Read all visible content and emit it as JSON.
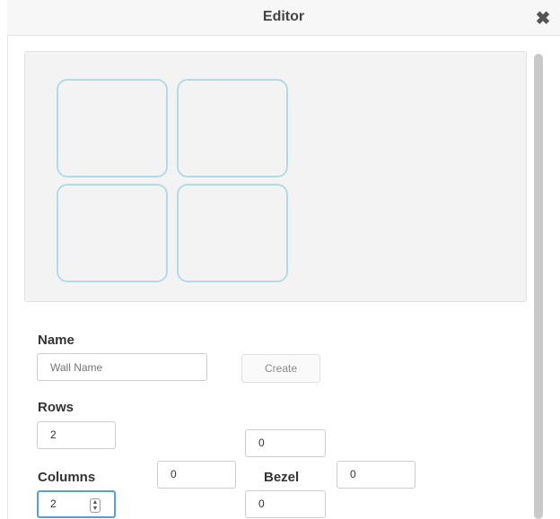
{
  "dialog": {
    "title": "Editor",
    "close_icon": "close-icon"
  },
  "preview": {
    "rows": 2,
    "columns": 2
  },
  "form": {
    "name_label": "Name",
    "name_placeholder": "Wall Name",
    "create_label": "Create",
    "rows_label": "Rows",
    "rows_value": "2",
    "columns_label": "Columns",
    "columns_value": "2",
    "bezel_label": "Bezel",
    "offset_top_value": "0",
    "offset_left_value": "0",
    "bezel_value": "0",
    "offset_bottom_value": "0"
  },
  "colors": {
    "cell_border": "#b3dbe6",
    "focus_border": "#5b9dd9"
  }
}
